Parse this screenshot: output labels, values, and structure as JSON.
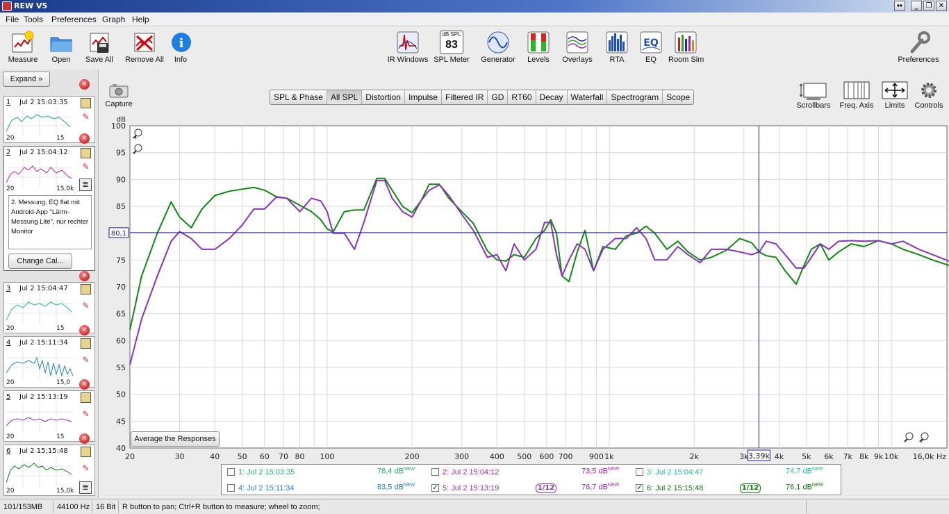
{
  "window": {
    "title": "REW V5"
  },
  "menu": [
    "File",
    "Tools",
    "Preferences",
    "Graph",
    "Help"
  ],
  "toolbar": {
    "left": [
      {
        "label": "Measure",
        "icon": "measure-icon"
      },
      {
        "label": "Open",
        "icon": "folder-icon"
      },
      {
        "label": "Save All",
        "icon": "save-icon"
      },
      {
        "label": "Remove All",
        "icon": "remove-all-icon"
      },
      {
        "label": "Info",
        "icon": "info-icon"
      }
    ],
    "center": [
      {
        "label": "IR Windows",
        "icon": "ir-windows-icon"
      },
      {
        "label": "SPL Meter",
        "icon": "spl-meter-icon",
        "badge_top": "dB SPL",
        "badge_value": "83"
      },
      {
        "label": "Generator",
        "icon": "generator-icon"
      },
      {
        "label": "Levels",
        "icon": "levels-icon"
      },
      {
        "label": "Overlays",
        "icon": "overlays-icon"
      },
      {
        "label": "RTA",
        "icon": "rta-icon"
      },
      {
        "label": "EQ",
        "icon": "eq-icon"
      },
      {
        "label": "Room Sim",
        "icon": "room-sim-icon"
      }
    ],
    "right": {
      "label": "Preferences",
      "icon": "wrench-icon"
    }
  },
  "sidebar": {
    "expand_label": "Expand",
    "measurements": [
      {
        "num": "1",
        "date": "Jul 2 15:03:35",
        "lo": "20",
        "hi": "15",
        "color": "#22aa77"
      },
      {
        "num": "2",
        "date": "Jul 2 15:04:12",
        "lo": "20",
        "hi": "15,0k",
        "color": "#aa22aa"
      },
      {
        "num": "3",
        "date": "Jul 2 15:04:47",
        "lo": "20",
        "hi": "15",
        "color": "#22bb99"
      },
      {
        "num": "4",
        "date": "Jul 2 15:11:34",
        "lo": "20",
        "hi": "15,0",
        "color": "#2a7fb8"
      },
      {
        "num": "5",
        "date": "Jul 2 15:13:19",
        "lo": "20",
        "hi": "15",
        "color": "#8833aa"
      },
      {
        "num": "6",
        "date": "Jul 2 15:15:48",
        "lo": "20",
        "hi": "15,0k",
        "color": "#117711"
      }
    ],
    "notes": "2. Messung, EQ flat mit Android-App \"Lärm-Messung Lite\", nur rechter Monitor",
    "change_cal_label": "Change Cal..."
  },
  "capture_label": "Capture",
  "tabs": [
    "SPL & Phase",
    "All SPL",
    "Distortion",
    "Impulse",
    "Filtered IR",
    "GD",
    "RT60",
    "Decay",
    "Waterfall",
    "Spectrogram",
    "Scope"
  ],
  "active_tab": "All SPL",
  "right_tools": [
    {
      "label": "Scrollbars",
      "icon": "scrollbars-icon"
    },
    {
      "label": "Freq. Axis",
      "icon": "freq-axis-icon"
    },
    {
      "label": "Limits",
      "icon": "limits-icon"
    },
    {
      "label": "Controls",
      "icon": "gear-icon"
    }
  ],
  "average_label": "Average the Responses",
  "chart_data": {
    "type": "line",
    "ylabel": "dB",
    "ylim": [
      40,
      100
    ],
    "xlim": [
      20,
      16000
    ],
    "xscale": "log",
    "grid": true,
    "y_ticks": [
      40,
      45,
      50,
      55,
      60,
      65,
      70,
      75,
      80,
      85,
      90,
      95,
      100
    ],
    "x_ticks": [
      {
        "v": 20,
        "t": "20"
      },
      {
        "v": 30,
        "t": "30"
      },
      {
        "v": 40,
        "t": "40"
      },
      {
        "v": 50,
        "t": "50"
      },
      {
        "v": 60,
        "t": "60"
      },
      {
        "v": 70,
        "t": "70"
      },
      {
        "v": 80,
        "t": "80"
      },
      {
        "v": 100,
        "t": "100"
      },
      {
        "v": 200,
        "t": "200"
      },
      {
        "v": 300,
        "t": "300"
      },
      {
        "v": 400,
        "t": "400"
      },
      {
        "v": 500,
        "t": "500"
      },
      {
        "v": 600,
        "t": "600"
      },
      {
        "v": 700,
        "t": "700"
      },
      {
        "v": 900,
        "t": "900"
      },
      {
        "v": 1000,
        "t": "1k"
      },
      {
        "v": 2000,
        "t": "2k"
      },
      {
        "v": 3000,
        "t": "3k"
      },
      {
        "v": 4000,
        "t": "4k"
      },
      {
        "v": 5000,
        "t": "5k"
      },
      {
        "v": 6000,
        "t": "6k"
      },
      {
        "v": 7000,
        "t": "7k"
      },
      {
        "v": 8000,
        "t": "8k"
      },
      {
        "v": 9000,
        "t": "9k"
      },
      {
        "v": 10000,
        "t": "10k"
      }
    ],
    "x_end_label": "16,0k Hz",
    "cursor": {
      "x": 3390,
      "x_label": "3,39k",
      "y": 80.1,
      "y_label": "80,1"
    },
    "series": [
      {
        "name": "6: Jul 2 15:15:48",
        "color": "#118811",
        "x": [
          20,
          22,
          25,
          28,
          30,
          33,
          36,
          40,
          45,
          50,
          55,
          60,
          66,
          72,
          80,
          88,
          95,
          100,
          105,
          115,
          125,
          135,
          150,
          160,
          170,
          185,
          200,
          215,
          230,
          250,
          270,
          300,
          330,
          370,
          400,
          430,
          460,
          500,
          550,
          590,
          620,
          650,
          680,
          720,
          770,
          820,
          880,
          950,
          1050,
          1150,
          1250,
          1350,
          1450,
          1600,
          1750,
          1900,
          2100,
          2300,
          2600,
          2900,
          3200,
          3400,
          3600,
          3900,
          4200,
          4600,
          4900,
          5200,
          5600,
          6000,
          6500,
          7200,
          8000,
          9000,
          10000,
          11000,
          12500,
          14000,
          16000
        ],
        "y": [
          62,
          72,
          80,
          85.8,
          83,
          81,
          84.5,
          87,
          87.8,
          88.2,
          88.5,
          88,
          86.8,
          86.5,
          85.2,
          84,
          82.5,
          80.8,
          80.2,
          84,
          84.3,
          84.3,
          90.2,
          90.2,
          88,
          85,
          83.8,
          86,
          89.1,
          89.1,
          86.5,
          84,
          81.8,
          76.7,
          75,
          74.8,
          76,
          75.5,
          79,
          80.5,
          82.5,
          80,
          72,
          71,
          76.5,
          80.5,
          73,
          77.5,
          77,
          79.5,
          80,
          81.3,
          80,
          77,
          78.5,
          76.5,
          75,
          75.5,
          76.8,
          79,
          78.2,
          76.5,
          75.8,
          75.5,
          73,
          70.5,
          74,
          77,
          78,
          75,
          76.5,
          78,
          77.5,
          78.6,
          78,
          77,
          76,
          75,
          74
        ]
      },
      {
        "name": "5: Jul 2 15:13:19",
        "color": "#8833bb",
        "x": [
          20,
          22,
          25,
          28,
          30,
          33,
          36,
          40,
          45,
          50,
          55,
          60,
          66,
          72,
          80,
          88,
          95,
          100,
          105,
          115,
          125,
          135,
          150,
          160,
          170,
          185,
          200,
          215,
          230,
          250,
          270,
          300,
          330,
          370,
          400,
          430,
          460,
          500,
          550,
          590,
          620,
          650,
          680,
          720,
          770,
          820,
          880,
          950,
          1050,
          1150,
          1250,
          1350,
          1450,
          1600,
          1750,
          1900,
          2100,
          2300,
          2600,
          2900,
          3200,
          3400,
          3600,
          3900,
          4200,
          4600,
          4900,
          5200,
          5600,
          6000,
          6500,
          7200,
          8000,
          9000,
          10000,
          11000,
          12500,
          14000,
          16000
        ],
        "y": [
          55.5,
          64,
          72,
          78.5,
          80.3,
          79,
          77,
          77,
          79,
          81.5,
          84.5,
          84.5,
          86.7,
          86.5,
          84,
          86.5,
          86,
          84,
          80,
          80,
          77,
          82,
          89.8,
          89.8,
          86.5,
          84,
          83,
          86,
          88,
          89,
          87,
          83.5,
          80.5,
          75.5,
          76,
          73,
          78,
          75,
          77,
          82,
          82,
          76,
          72,
          75,
          78,
          77,
          73,
          77,
          79,
          79,
          81,
          79,
          75,
          75,
          77.5,
          76,
          74.5,
          77,
          77,
          76.5,
          76,
          76.5,
          78.5,
          78,
          76,
          73.5,
          73.5,
          75.5,
          78,
          77,
          78.5,
          78.6,
          78.5,
          78.6,
          78,
          78.5,
          77,
          76,
          74.8
        ]
      }
    ]
  },
  "legend": [
    {
      "checked": false,
      "name": "1: Jul 2 15:03:35",
      "value": "78,4 dB",
      "sup": "NEW",
      "color": "#22aa77"
    },
    {
      "checked": false,
      "name": "2: Jul 2 15:04:12",
      "value": "73,5 dB",
      "sup": "NEW",
      "color": "#aa22aa"
    },
    {
      "checked": false,
      "name": "3: Jul 2 15:04:47",
      "value": "74,7 dB",
      "sup": "NEW",
      "color": "#22bb99"
    },
    {
      "checked": false,
      "name": "4: Jul 2 15:11:34",
      "value": "83,5 dB",
      "sup": "NEW",
      "color": "#2a7fb8"
    },
    {
      "checked": true,
      "name": "5: Jul 2 15:13:19",
      "value": "76,7 dB",
      "sup": "NEW",
      "color": "#8833aa",
      "smooth": "1/12"
    },
    {
      "checked": true,
      "name": "6: Jul 2 15:15:48",
      "value": "76,1 dB",
      "sup": "NEW",
      "color": "#117711",
      "smooth": "1/12"
    }
  ],
  "status": {
    "memory": "101/153MB",
    "rate": "44100 Hz",
    "bits": "16 Bit",
    "hint": "R button to pan; Ctrl+R button to measure; wheel to zoom;"
  }
}
